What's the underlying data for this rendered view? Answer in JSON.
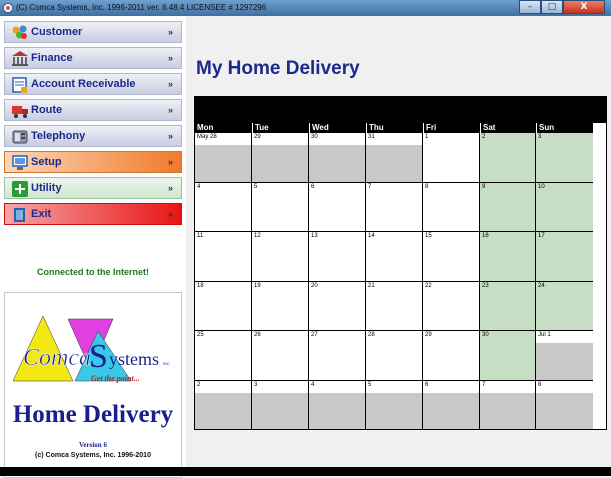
{
  "window": {
    "title": "(C) Comca Systems, Inc. 1996-2011 ver. 6.48.4  LICENSEE # 1297296",
    "buttons": {
      "minimize": "–",
      "maximize": "□",
      "close": "X"
    }
  },
  "sidebar": {
    "items": [
      {
        "label": "Customer",
        "icon": "people-icon",
        "expand": "»"
      },
      {
        "label": "Finance",
        "icon": "bank-icon",
        "expand": "»"
      },
      {
        "label": "Account Receivable",
        "icon": "ledger-icon",
        "expand": "»"
      },
      {
        "label": "Route",
        "icon": "truck-icon",
        "expand": "»"
      },
      {
        "label": "Telephony",
        "icon": "phone-icon",
        "expand": "»"
      },
      {
        "label": "Setup",
        "icon": "monitor-icon",
        "expand": "»"
      },
      {
        "label": "Utility",
        "icon": "plus-icon",
        "expand": "»"
      },
      {
        "label": "Exit",
        "icon": "door-icon",
        "expand": "»"
      }
    ],
    "status": "Connected to the Internet!",
    "logo": {
      "brand_word_1": "Comca",
      "brand_word_2": "ystems",
      "brand_initial": "S",
      "brand_suffix": "INC",
      "tagline": "Get the point...",
      "product": "Home Delivery",
      "version": "Version 6",
      "copyright": "(c) Comca Systems, Inc. 1996-2010"
    }
  },
  "main": {
    "title": "My Home Delivery",
    "calendar": {
      "headers": [
        "Mon",
        "Tue",
        "Wed",
        "Thu",
        "Fri",
        "Sat",
        "Sun"
      ],
      "weeks": [
        [
          {
            "d": "May 28",
            "o": true
          },
          {
            "d": "29",
            "o": true
          },
          {
            "d": "30",
            "o": true
          },
          {
            "d": "31",
            "o": true
          },
          {
            "d": "1"
          },
          {
            "d": "2"
          },
          {
            "d": "3"
          }
        ],
        [
          {
            "d": "4"
          },
          {
            "d": "5"
          },
          {
            "d": "6"
          },
          {
            "d": "7"
          },
          {
            "d": "8"
          },
          {
            "d": "9"
          },
          {
            "d": "10"
          }
        ],
        [
          {
            "d": "11"
          },
          {
            "d": "12"
          },
          {
            "d": "13"
          },
          {
            "d": "14"
          },
          {
            "d": "15"
          },
          {
            "d": "16"
          },
          {
            "d": "17"
          }
        ],
        [
          {
            "d": "18"
          },
          {
            "d": "19"
          },
          {
            "d": "20"
          },
          {
            "d": "21"
          },
          {
            "d": "22"
          },
          {
            "d": "23"
          },
          {
            "d": "24"
          }
        ],
        [
          {
            "d": "25"
          },
          {
            "d": "26"
          },
          {
            "d": "27"
          },
          {
            "d": "28"
          },
          {
            "d": "29"
          },
          {
            "d": "30"
          },
          {
            "d": "Jul 1",
            "o": true
          }
        ],
        [
          {
            "d": "2",
            "o": true
          },
          {
            "d": "3",
            "o": true
          },
          {
            "d": "4",
            "o": true
          },
          {
            "d": "5",
            "o": true
          },
          {
            "d": "6",
            "o": true
          },
          {
            "d": "7",
            "o": true
          },
          {
            "d": "8",
            "o": true
          }
        ]
      ]
    }
  },
  "colors": {
    "accent": "#1a2a8c",
    "weekend": "#c6dfc4",
    "other_month": "#c8c8c8",
    "status_green": "#1d7a1d"
  }
}
